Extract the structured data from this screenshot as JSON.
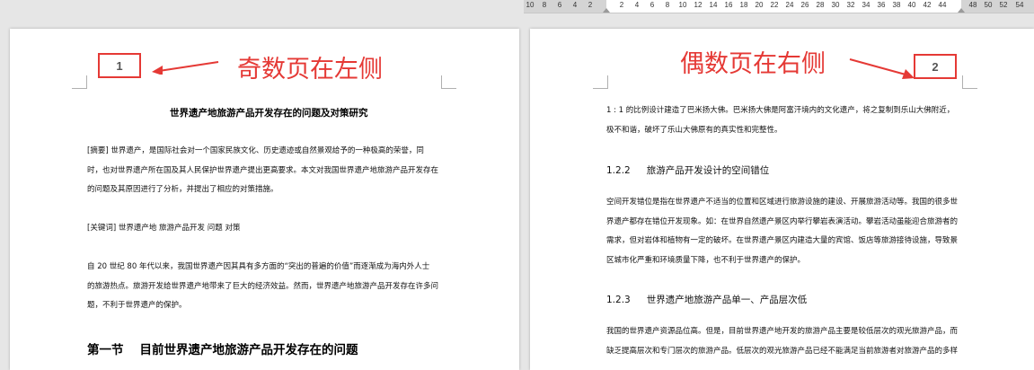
{
  "ruler": {
    "numbers": [
      "10",
      "8",
      "6",
      "4",
      "2",
      "2",
      "4",
      "6",
      "8",
      "10",
      "12",
      "14",
      "16",
      "18",
      "20",
      "22",
      "24",
      "26",
      "28",
      "30",
      "32",
      "34",
      "36",
      "38",
      "40",
      "42",
      "44",
      "48",
      "50",
      "52",
      "54"
    ]
  },
  "left_page": {
    "page_number": "1",
    "annotation": "奇数页在左侧",
    "title": "世界遗产地旅游产品开发存在的问题及对策研究",
    "abstract_lines": [
      "[摘要] 世界遗产，是国际社会对一个国家民族文化、历史遗迹或自然景观给予的一种极高的荣誉，同",
      "时，也对世界遗产所在国及其人民保护世界遗产提出更高要求。本文对我国世界遗产地旅游产品开发存在",
      "的问题及其原因进行了分析，并提出了相应的对策措施。"
    ],
    "keywords": "[关键词]  世界遗产地    旅游产品开发    问题    对策",
    "intro_lines": [
      "自 20 世纪 80 年代以来，我国世界遗产因其具有多方面的“突出的普遍的价值”而逐渐成为海内外人士",
      "的旅游热点。旅游开发给世界遗产地带来了巨大的经济效益。然而，世界遗产地旅游产品开发存在许多问",
      "题，不利于世界遗产的保护。"
    ],
    "section_number": "第一节",
    "section_title": "目前世界遗产地旅游产品开发存在的问题"
  },
  "right_page": {
    "page_number": "2",
    "annotation": "偶数页在右侧",
    "opening_lines": [
      "1 : 1  的比例设计建造了巴米扬大佛。巴米扬大佛是阿富汗境内的文化遗产，将之复制到乐山大佛附近，",
      "极不和谐，破坏了乐山大佛原有的真实性和完整性。"
    ],
    "heading_122_number": "1.2.2",
    "heading_122_title": "旅游产品开发设计的空间错位",
    "para_122_lines": [
      "空间开发错位是指在世界遗产不适当的位置和区域进行旅游设施的建设、开展旅游活动等。我国的很多世",
      "界遗产都存在错位开发现象。如：在世界自然遗产景区内举行攀岩表演活动。攀岩活动虽能迎合旅游者的",
      "需求，但对岩体和植物有一定的破坏。在世界遗产景区内建造大量的宾馆、饭店等旅游接待设施，导致景",
      "区城市化严重和环境质量下降，也不利于世界遗产的保护。"
    ],
    "heading_123_number": "1.2.3",
    "heading_123_title": "世界遗产地旅游产品单一、产品层次低",
    "para_123_lines": [
      "我国的世界遗产资源品位高。但是，目前世界遗产地开发的旅游产品主要是较低层次的观光旅游产品，而",
      "缺乏提高层次和专门层次的旅游产品。低层次的观光旅游产品已经不能满足当前旅游者对旅游产品的多样"
    ]
  },
  "colors": {
    "annotation": "#e53935",
    "ruler_margin": "#d4d4d4",
    "canvas": "#e6e6e6"
  }
}
